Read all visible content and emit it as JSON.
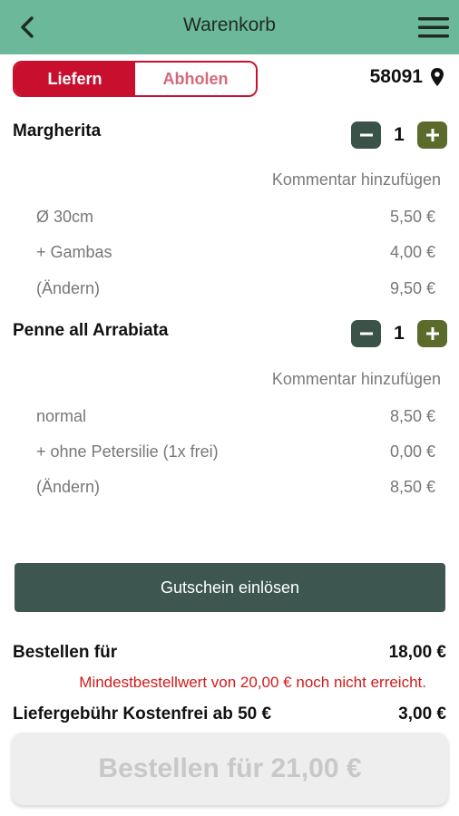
{
  "header": {
    "title": "Warenkorb",
    "back_icon": "chevron-left-icon",
    "menu_icon": "hamburger-menu-icon"
  },
  "delivery_toggle": {
    "options": [
      "Liefern",
      "Abholen"
    ],
    "selected": "Liefern"
  },
  "location": {
    "postcode": "58091",
    "icon": "map-pin-icon"
  },
  "items": [
    {
      "name": "Margherita",
      "quantity": "1",
      "comment_label": "Kommentar hinzufügen",
      "details": [
        {
          "label": "Ø 30cm",
          "price": "5,50 €"
        },
        {
          "label": "+ Gambas",
          "price": "4,00 €"
        },
        {
          "label": "(Ändern)",
          "price": "9,50 €"
        }
      ]
    },
    {
      "name": "Penne all Arrabiata",
      "quantity": "1",
      "comment_label": "Kommentar hinzufügen",
      "details": [
        {
          "label": "normal",
          "price": "8,50 €"
        },
        {
          "label": "+ ohne Petersilie (1x frei)",
          "price": "0,00 €"
        },
        {
          "label": "(Ändern)",
          "price": "8,50 €"
        }
      ]
    }
  ],
  "voucher_label": "Gutschein einlösen",
  "summary": {
    "order_for_label": "Bestellen für",
    "order_for_value": "18,00 €",
    "minimum_warning": "Mindestbestellwert von 20,00 € noch nicht erreicht.",
    "delivery_fee_label": "Liefergebühr Kostenfrei ab 50 €",
    "delivery_fee_value": "3,00 €"
  },
  "order_button_label": "Bestellen für 21,00 €",
  "colors": {
    "header_bg": "#6cb89a",
    "accent_red": "#c8102e",
    "minus_btn": "#3b5249",
    "plus_btn": "#5b6b2c",
    "voucher_btn": "#3d5650",
    "warning": "#d21a1a"
  }
}
